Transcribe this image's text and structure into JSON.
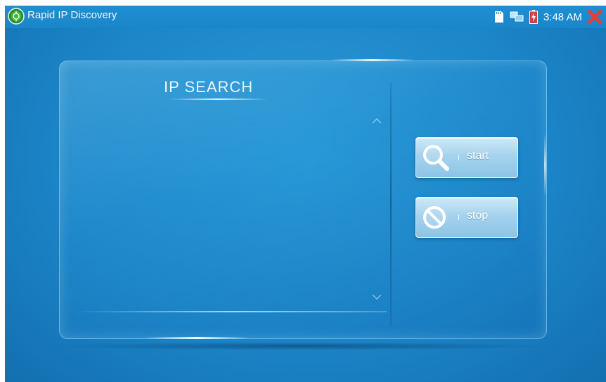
{
  "titlebar": {
    "app_title": "Rapid IP Discovery",
    "app_icon": "app-globe-icon",
    "clock": "3:48 AM",
    "status_icons": [
      "sd-card-icon",
      "network-icon",
      "battery-charging-icon",
      "close-icon"
    ]
  },
  "panel": {
    "title": "IP SEARCH",
    "results": []
  },
  "buttons": {
    "start_label": "start",
    "stop_label": "stop"
  },
  "colors": {
    "background": "#1c86c8",
    "close": "#e0403a",
    "battery": "#d64040"
  }
}
